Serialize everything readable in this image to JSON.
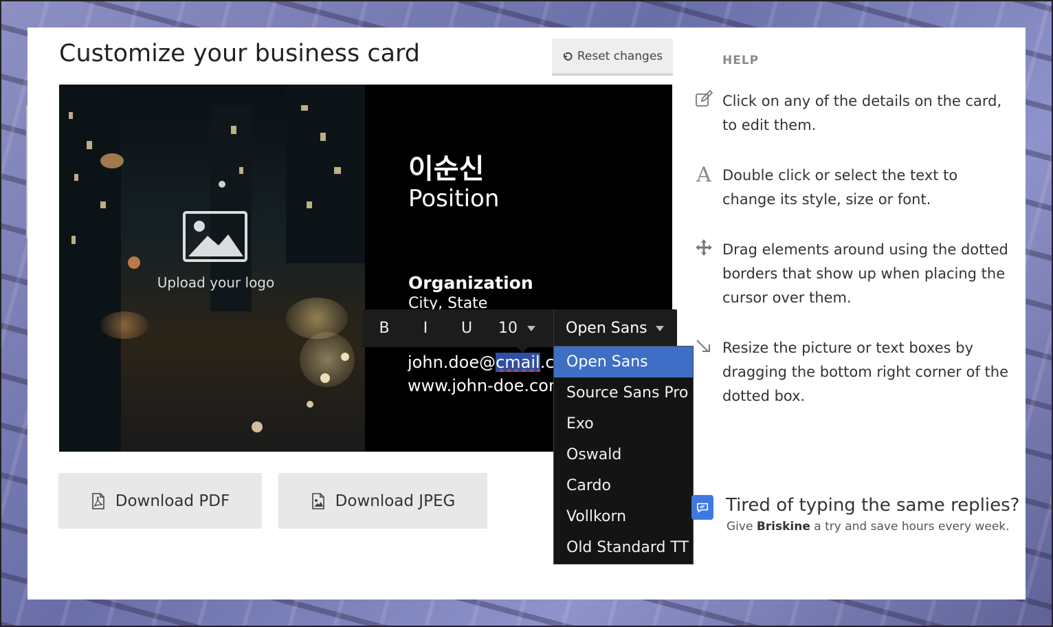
{
  "page": {
    "title": "Customize your business card",
    "reset_label": "Reset changes"
  },
  "card": {
    "logo_text": "Upload your logo",
    "name": "이순신",
    "position": "Position",
    "organization": "Organization",
    "city": "City, State",
    "email_prefix": "john.doe@",
    "email_selected": "cmail",
    "email_suffix": ".com",
    "website": "www.john-doe.com"
  },
  "toolbar": {
    "bold": "B",
    "italic": "I",
    "underline": "U",
    "font_size": "10",
    "font_family": "Open Sans"
  },
  "font_options": [
    "Open Sans",
    "Source Sans Pro",
    "Exo",
    "Oswald",
    "Cardo",
    "Vollkorn",
    "Old Standard TT"
  ],
  "downloads": {
    "pdf_label": "Download PDF",
    "jpeg_label": "Download JPEG"
  },
  "help": {
    "title": "HELP",
    "items": [
      {
        "icon": "edit-icon",
        "text": "Click on any of the details on the card, to edit them."
      },
      {
        "icon": "font-icon",
        "text": "Double click or select the text to change its style, size or font."
      },
      {
        "icon": "move-icon",
        "text": "Drag elements around using the dotted borders that show up when placing the cursor over them."
      },
      {
        "icon": "resize-icon",
        "text": "Resize the picture or text boxes by dragging the bottom right corner of the dotted box."
      }
    ]
  },
  "promo": {
    "title": "Tired of typing the same replies?",
    "sub_before": "Give ",
    "brand": "Briskine",
    "sub_after": " a try and save hours every week."
  },
  "colors": {
    "accent": "#3f6fc4",
    "card_bg": "#000000",
    "toolbar_bg": "#1c1c1c",
    "brand": "#3f79e0"
  }
}
